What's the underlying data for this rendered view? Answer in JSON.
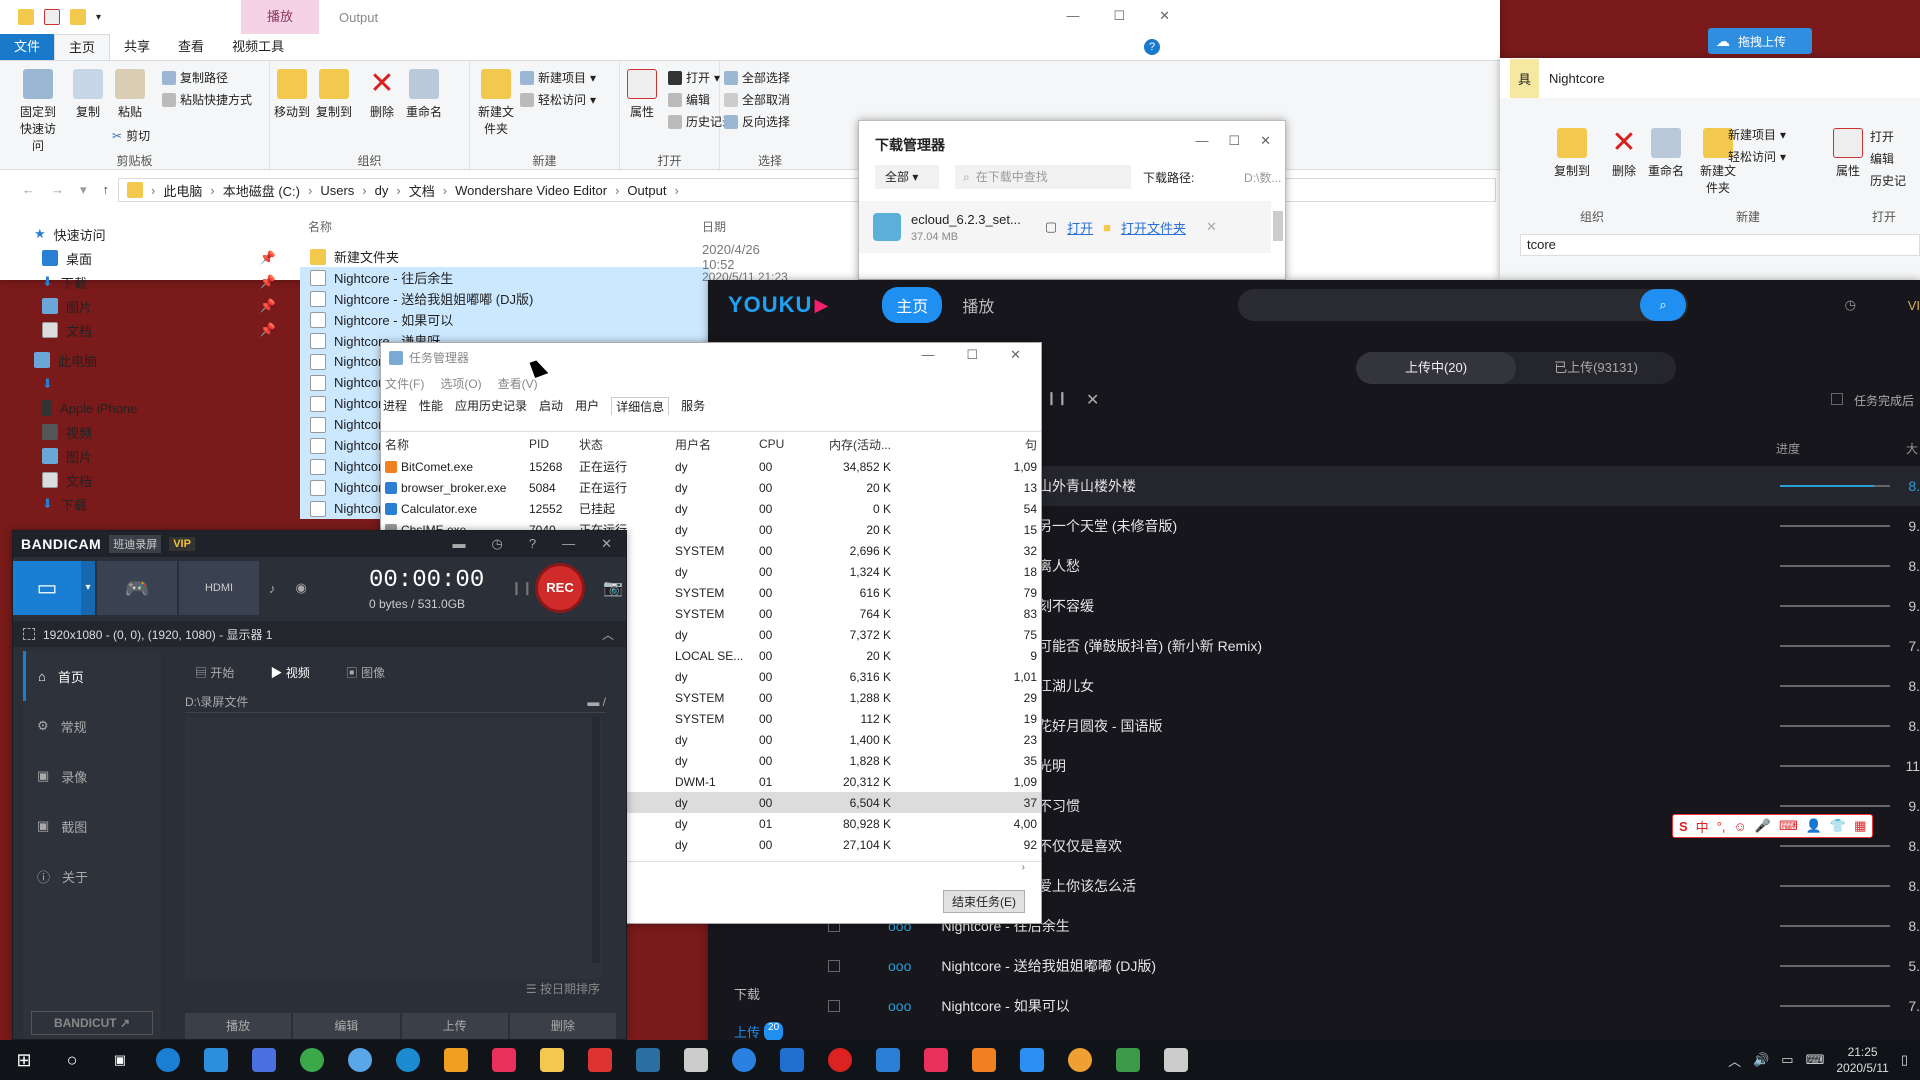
{
  "explorer": {
    "title_tab_play": "播放",
    "title_output": "Output",
    "tabs": [
      "文件",
      "主页",
      "共享",
      "查看",
      "视频工具"
    ],
    "clipboard": {
      "pin": "固定到快速访问",
      "copy": "复制",
      "paste": "粘贴",
      "copy_path": "复制路径",
      "paste_shortcut": "粘贴快捷方式",
      "cut": "剪切",
      "label": "剪贴板"
    },
    "organize": {
      "move_to": "移动到",
      "copy_to": "复制到",
      "delete": "删除",
      "rename": "重命名",
      "label": "组织"
    },
    "new": {
      "new_folder": "新建文件夹",
      "new_item": "新建项目",
      "easy_access": "轻松访问",
      "label": "新建"
    },
    "open": {
      "properties": "属性",
      "open": "打开",
      "edit": "编辑",
      "history": "历史记录",
      "label": "打开"
    },
    "select": {
      "select_all": "全部选择",
      "select_none": "全部取消",
      "invert": "反向选择",
      "label": "选择"
    },
    "breadcrumb": [
      "此电脑",
      "本地磁盘 (C:)",
      "Users",
      "dy",
      "文档",
      "Wondershare Video Editor",
      "Output"
    ],
    "col_name": "名称",
    "col_date": "日期",
    "nav": [
      "快速访问",
      "桌面",
      "下载",
      "图片",
      "文档",
      "此电脑",
      "Apple iPhone",
      "视频",
      "图片",
      "文档",
      "下载"
    ],
    "files": [
      {
        "name": "新建文件夹",
        "date": "2020/4/26 10:52"
      },
      {
        "name": "Nightcore - 往后余生",
        "date": "2020/5/11 21:23"
      },
      {
        "name": "Nightcore - 送给我姐姐嘟嘟 (DJ版)",
        "date": ""
      },
      {
        "name": "Nightcore - 如果可以",
        "date": ""
      },
      {
        "name": "Nightcore - 谦卑呀",
        "date": ""
      },
      {
        "name": "Nightcor",
        "date": ""
      },
      {
        "name": "Nightcor",
        "date": ""
      },
      {
        "name": "Nightcor",
        "date": ""
      },
      {
        "name": "Nightcor",
        "date": ""
      },
      {
        "name": "Nightcor",
        "date": ""
      },
      {
        "name": "Nightcor",
        "date": ""
      },
      {
        "name": "Nightcor",
        "date": ""
      },
      {
        "name": "Nightcor",
        "date": ""
      }
    ]
  },
  "explorer2": {
    "title": "Nightcore",
    "tab_tools": "具",
    "copy_to": "复制到",
    "delete": "删除",
    "rename": "重命名",
    "new_folder": "新建文件夹",
    "new_item": "新建项目",
    "easy_access": "轻松访问",
    "properties": "属性",
    "open": "打开",
    "edit": "编辑",
    "history": "历史记",
    "organize": "组织",
    "new_label": "新建",
    "open_label": "打开",
    "addr": "tcore"
  },
  "top_button": "拖拽上传",
  "download_manager": {
    "title": "下载管理器",
    "filter": "全部",
    "search_placeholder": "在下载中查找",
    "path_label": "下载路径:",
    "path_value": "D:\\数...",
    "item_name": "ecloud_6.2.3_set...",
    "item_size": "37.04 MB",
    "open": "打开",
    "open_folder": "打开文件夹"
  },
  "youku": {
    "logo": "YOUKU",
    "nav_home": "主页",
    "nav_play": "播放",
    "tab_uploading": "上传中(20)",
    "tab_uploaded": "已上传(93131)",
    "complete_option": "任务完成后",
    "col_progress": "进度",
    "col_size": "大",
    "sidebar_download": "下载",
    "sidebar_upload": "上传",
    "upload_count": "20",
    "rows": [
      {
        "title": "山外青山楼外楼",
        "size": "8.",
        "progress": 0.85
      },
      {
        "title": "另一个天堂 (未修音版)",
        "size": "9.",
        "progress": 0
      },
      {
        "title": "离人愁",
        "size": "8.",
        "progress": 0
      },
      {
        "title": "刻不容缓",
        "size": "9.",
        "progress": 0
      },
      {
        "title": "可能否 (弹鼓版抖音) (新小新 Remix)",
        "size": "7.",
        "progress": 0
      },
      {
        "title": "江湖儿女",
        "size": "8.",
        "progress": 0
      },
      {
        "title": "花好月圆夜 - 国语版",
        "size": "8.",
        "progress": 0
      },
      {
        "title": "光明",
        "size": "11",
        "progress": 0
      },
      {
        "title": "不习惯",
        "size": "9.",
        "progress": 0
      },
      {
        "title": "不仅仅是喜欢",
        "size": "8.",
        "progress": 0
      },
      {
        "title": "爱上你该怎么活",
        "size": "8.",
        "progress": 0
      },
      {
        "title": "Nightcore - 往后余生",
        "size": "8.",
        "progress": 0
      },
      {
        "title": "Nightcore - 送给我姐姐嘟嘟 (DJ版)",
        "size": "5.",
        "progress": 0
      },
      {
        "title": "Nightcore - 如果可以",
        "size": "7.",
        "progress": 0
      }
    ]
  },
  "task_manager": {
    "title": "任务管理器",
    "menu": [
      "文件(F)",
      "选项(O)",
      "查看(V)"
    ],
    "tabs": [
      "进程",
      "性能",
      "应用历史记录",
      "启动",
      "用户",
      "详细信息",
      "服务"
    ],
    "columns": [
      "名称",
      "PID",
      "状态",
      "用户名",
      "CPU",
      "内存(活动...",
      "句"
    ],
    "rows": [
      {
        "name": "BitComet.exe",
        "pid": "15268",
        "status": "正在运行",
        "user": "dy",
        "cpu": "00",
        "mem": "34,852 K",
        "h": "1,09"
      },
      {
        "name": "browser_broker.exe",
        "pid": "5084",
        "status": "正在运行",
        "user": "dy",
        "cpu": "00",
        "mem": "20 K",
        "h": "13"
      },
      {
        "name": "Calculator.exe",
        "pid": "12552",
        "status": "已挂起",
        "user": "dy",
        "cpu": "00",
        "mem": "0 K",
        "h": "54"
      },
      {
        "name": "ChsIME.exe",
        "pid": "7040",
        "status": "正在运行",
        "user": "dy",
        "cpu": "00",
        "mem": "20 K",
        "h": "15"
      },
      {
        "name": "",
        "pid": "",
        "status": "",
        "user": "SYSTEM",
        "cpu": "00",
        "mem": "2,696 K",
        "h": "32"
      },
      {
        "name": "",
        "pid": "",
        "status": "",
        "user": "dy",
        "cpu": "00",
        "mem": "1,324 K",
        "h": "18"
      },
      {
        "name": "",
        "pid": "",
        "status": "",
        "user": "SYSTEM",
        "cpu": "00",
        "mem": "616 K",
        "h": "79"
      },
      {
        "name": "",
        "pid": "",
        "status": "",
        "user": "SYSTEM",
        "cpu": "00",
        "mem": "764 K",
        "h": "83"
      },
      {
        "name": "",
        "pid": "",
        "status": "",
        "user": "dy",
        "cpu": "00",
        "mem": "7,372 K",
        "h": "75"
      },
      {
        "name": "",
        "pid": "",
        "status": "",
        "user": "LOCAL SE...",
        "cpu": "00",
        "mem": "20 K",
        "h": "9"
      },
      {
        "name": "",
        "pid": "",
        "status": "",
        "user": "dy",
        "cpu": "00",
        "mem": "6,316 K",
        "h": "1,01"
      },
      {
        "name": "",
        "pid": "",
        "status": "",
        "user": "SYSTEM",
        "cpu": "00",
        "mem": "1,288 K",
        "h": "29"
      },
      {
        "name": "",
        "pid": "",
        "status": "",
        "user": "SYSTEM",
        "cpu": "00",
        "mem": "112 K",
        "h": "19"
      },
      {
        "name": "",
        "pid": "",
        "status": "",
        "user": "dy",
        "cpu": "00",
        "mem": "1,400 K",
        "h": "23"
      },
      {
        "name": "",
        "pid": "",
        "status": "",
        "user": "dy",
        "cpu": "00",
        "mem": "1,828 K",
        "h": "35"
      },
      {
        "name": "",
        "pid": "",
        "status": "",
        "user": "DWM-1",
        "cpu": "01",
        "mem": "20,312 K",
        "h": "1,09"
      },
      {
        "name": "",
        "pid": "",
        "status": "",
        "user": "dy",
        "cpu": "00",
        "mem": "6,504 K",
        "h": "37"
      },
      {
        "name": "",
        "pid": "",
        "status": "",
        "user": "dy",
        "cpu": "01",
        "mem": "80,928 K",
        "h": "4,00"
      },
      {
        "name": "",
        "pid": "",
        "status": "",
        "user": "dy",
        "cpu": "00",
        "mem": "27,104 K",
        "h": "92"
      }
    ],
    "end_task": "结束任务(E)"
  },
  "bandicam": {
    "brand": "BANDICAM",
    "brand_sub": "班迪录屏",
    "vip": "VIP",
    "timer": "00:00:00",
    "size": "0 bytes / 531.0GB",
    "rec": "REC",
    "region": "1920x1080 - (0, 0), (1920, 1080) - 显示器 1",
    "menu": [
      "首页",
      "常规",
      "录像",
      "截图",
      "关于"
    ],
    "tabs": [
      "开始",
      "视频",
      "图像"
    ],
    "folder": "D:\\录屏文件",
    "sort": "按日期排序",
    "actions": [
      "播放",
      "编辑",
      "上传",
      "删除"
    ],
    "bandicut": "BANDICUT"
  },
  "taskbar": {
    "time": "21:25",
    "date": "2020/5/11"
  },
  "ime_toolbar": "中"
}
